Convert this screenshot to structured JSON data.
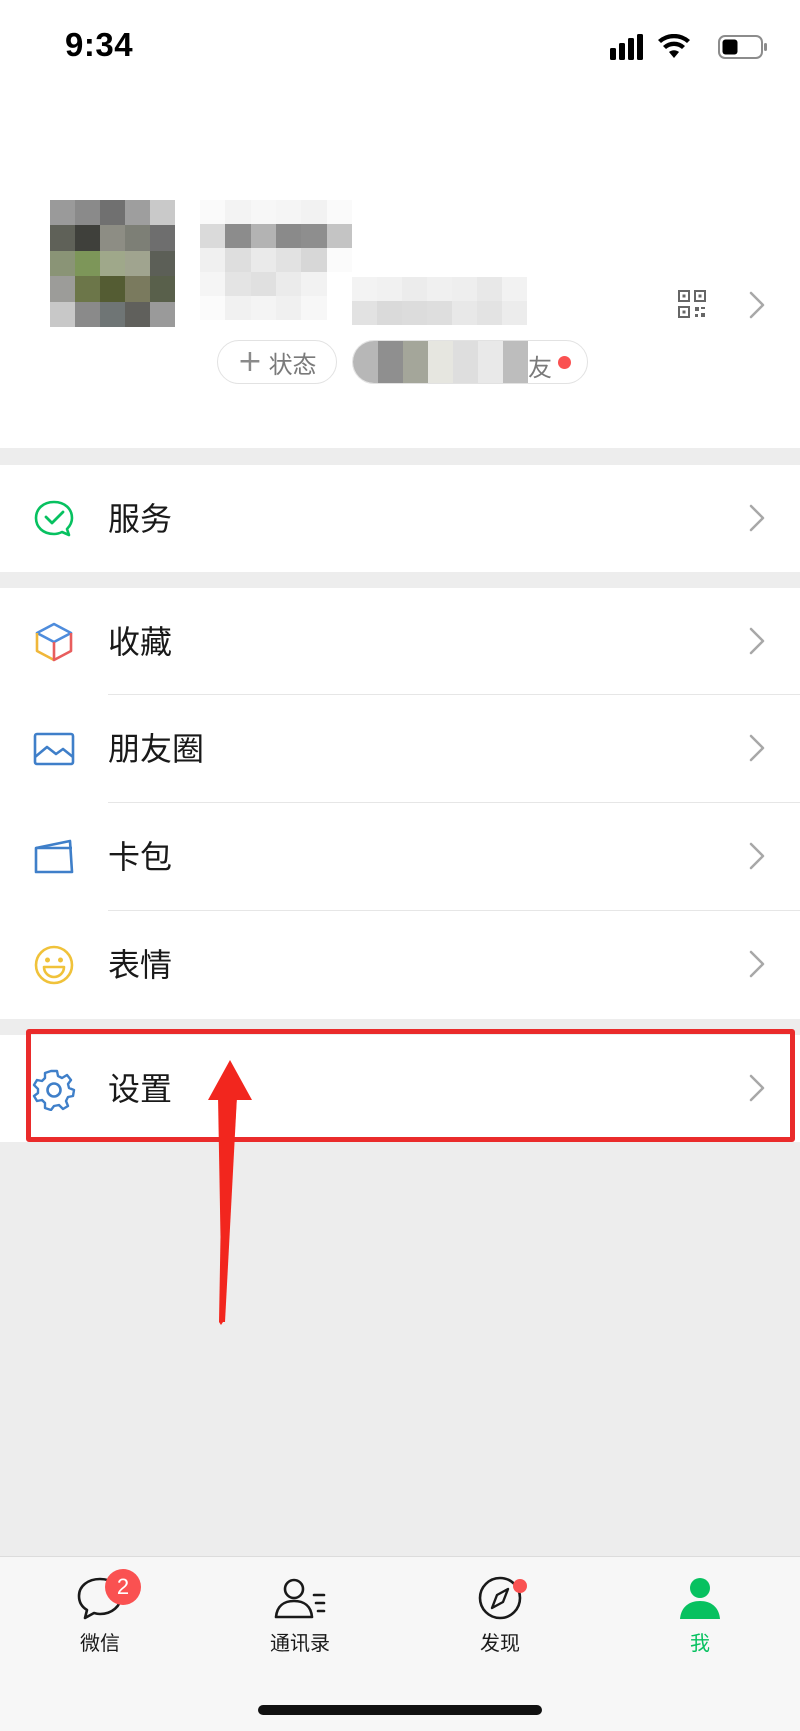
{
  "status_bar": {
    "time": "9:34"
  },
  "profile": {
    "status_button": {
      "plus": "+",
      "label": "状态"
    },
    "friend_chip_tail": "友"
  },
  "menu": {
    "services": {
      "label": "服务",
      "icon": "wechat-pay-check-icon"
    },
    "favorites": {
      "label": "收藏",
      "icon": "cube-icon"
    },
    "moments": {
      "label": "朋友圈",
      "icon": "landscape-picture-icon"
    },
    "cards": {
      "label": "卡包",
      "icon": "card-wallet-icon"
    },
    "stickers": {
      "label": "表情",
      "icon": "smiley-icon"
    },
    "settings": {
      "label": "设置",
      "icon": "gear-icon"
    }
  },
  "tabs": [
    {
      "label": "微信",
      "icon": "chat-bubble-icon",
      "badge": "2"
    },
    {
      "label": "通讯录",
      "icon": "contacts-icon"
    },
    {
      "label": "发现",
      "icon": "compass-icon"
    },
    {
      "label": "我",
      "icon": "person-icon",
      "active": true
    }
  ],
  "colors": {
    "accent_green": "#07c160",
    "badge_red": "#fa5151",
    "annotation_red": "#ea2b2b",
    "page_background": "#ededed"
  }
}
